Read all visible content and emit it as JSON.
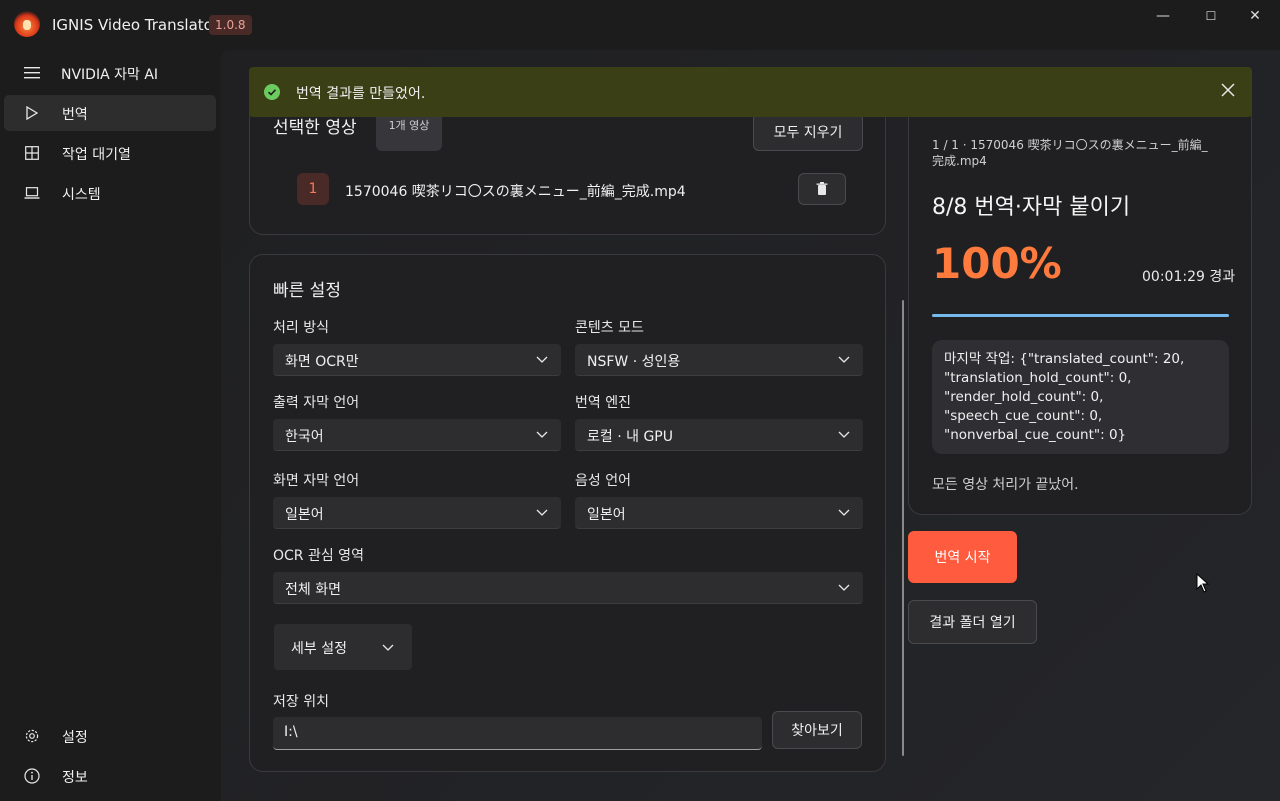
{
  "app": {
    "title": "IGNIS Video Translator",
    "version": "1.0.8"
  },
  "window": {
    "minimize": "—",
    "maximize": "☐",
    "close": "✕"
  },
  "sidebar": {
    "menu_title": "NVIDIA 자막 AI",
    "items": [
      {
        "label": "번역",
        "icon": "play-icon"
      },
      {
        "label": "작업 대기열",
        "icon": "grid-icon"
      },
      {
        "label": "시스템",
        "icon": "laptop-icon"
      }
    ],
    "bottom": [
      {
        "label": "설정",
        "icon": "gear-icon"
      },
      {
        "label": "정보",
        "icon": "info-icon"
      }
    ]
  },
  "toast": {
    "message": "번역 결과를 만들었어.",
    "status_color": "#6ccb5f"
  },
  "selected": {
    "title": "선택한 영상",
    "count_badge": "1개 영상",
    "clear_all": "모두 지우기",
    "files": [
      {
        "index": "1",
        "name": "1570046 喫茶リコ〇スの裏メニュー_前編_完成.mp4"
      }
    ]
  },
  "quick": {
    "title": "빠른 설정",
    "processing": {
      "label": "처리 방식",
      "value": "화면 OCR만"
    },
    "content_mode": {
      "label": "콘텐츠 모드",
      "value": "NSFW · 성인용"
    },
    "output_lang": {
      "label": "출력 자막 언어",
      "value": "한국어"
    },
    "engine": {
      "label": "번역 엔진",
      "value": "로컬 · 내 GPU"
    },
    "screen_lang": {
      "label": "화면 자막 언어",
      "value": "일본어"
    },
    "audio_lang": {
      "label": "음성 언어",
      "value": "일본어"
    },
    "ocr_region": {
      "label": "OCR 관심 영역",
      "value": "전체 화면"
    },
    "details": "세부 설정",
    "save": {
      "label": "저장 위치",
      "value": "I:\\",
      "browse": "찾아보기"
    }
  },
  "progress": {
    "file_line": "1 / 1 · 1570046 喫茶リコ〇スの裏メニュー_前編_完成.mp4",
    "step": "8/8  번역·자막 붙이기",
    "percent": "100%",
    "percent_value": 1.0,
    "elapsed": "00:01:29 경과",
    "last_job": "마지막 작업: {\"translated_count\": 20, \"translation_hold_count\": 0, \"render_hold_count\": 0, \"speech_cue_count\": 0, \"nonverbal_cue_count\": 0}",
    "done": "모든 영상 처리가 끝났어."
  },
  "actions": {
    "start": "번역 시작",
    "open_folder": "결과 폴더 열기"
  },
  "colors": {
    "accent": "#ff5b3f",
    "percent": "#ff7a3d",
    "progress": "#76b9ed"
  }
}
